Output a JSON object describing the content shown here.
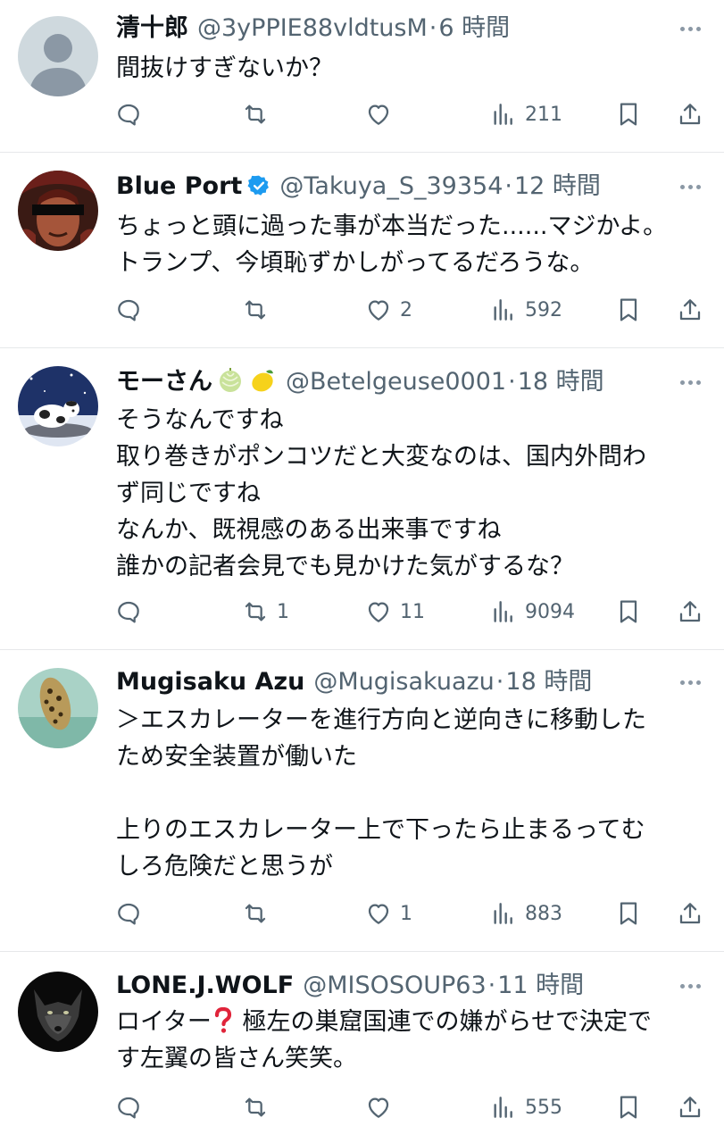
{
  "tweets": [
    {
      "name": "清十郎",
      "handle": "@3yPPIE88vldtusM",
      "time": "6 時間",
      "text": "間抜けすぎないか？",
      "replies": "",
      "retweets": "",
      "likes": "",
      "views": "211",
      "verified": false
    },
    {
      "name": "Blue Port",
      "handle": "@Takuya_S_39354",
      "time": "12 時間",
      "text": "ちょっと頭に過った事が本当だった......マジかよ。\nトランプ、今頃恥ずかしがってるだろうな。",
      "replies": "",
      "retweets": "",
      "likes": "2",
      "views": "592",
      "verified": true
    },
    {
      "name": "モーさん",
      "handle": "@Betelgeuse0001",
      "time": "18 時間",
      "text": "そうなんですね\n取り巻きがポンコツだと大変なのは、国内外問わ\nず同じですね\nなんか、既視感のある出来事ですね\n誰かの記者会見でも見かけた気がするな？",
      "replies": "",
      "retweets": "1",
      "likes": "11",
      "views": "9094",
      "name_emojis": [
        "melon",
        "lemon"
      ]
    },
    {
      "name": "Mugisaku Azu",
      "handle": "@Mugisakuazu",
      "time": "18 時間",
      "text": "＞エスカレーターを進行方向と逆向きに移動した\nため安全装置が働いた\n\n上りのエスカレーター上で下ったら止まるってむ\nしろ危険だと思うが",
      "replies": "",
      "retweets": "",
      "likes": "1",
      "views": "883"
    },
    {
      "name": "LONE.J.WOLF",
      "handle": "@MISOSOUP63",
      "time": "11 時間",
      "text_before": "ロイター",
      "text_after": " 極左の巣窟国連での嫌がらせで決定で\nす左翼の皆さん笑笑。",
      "text_emoji": "red-question-mark",
      "replies": "",
      "retweets": "",
      "likes": "",
      "views": "555"
    }
  ],
  "colors": {
    "text": "#0f1419",
    "secondary": "#536471",
    "verified": "#1d9bf0",
    "divider": "#e6e8ea"
  }
}
